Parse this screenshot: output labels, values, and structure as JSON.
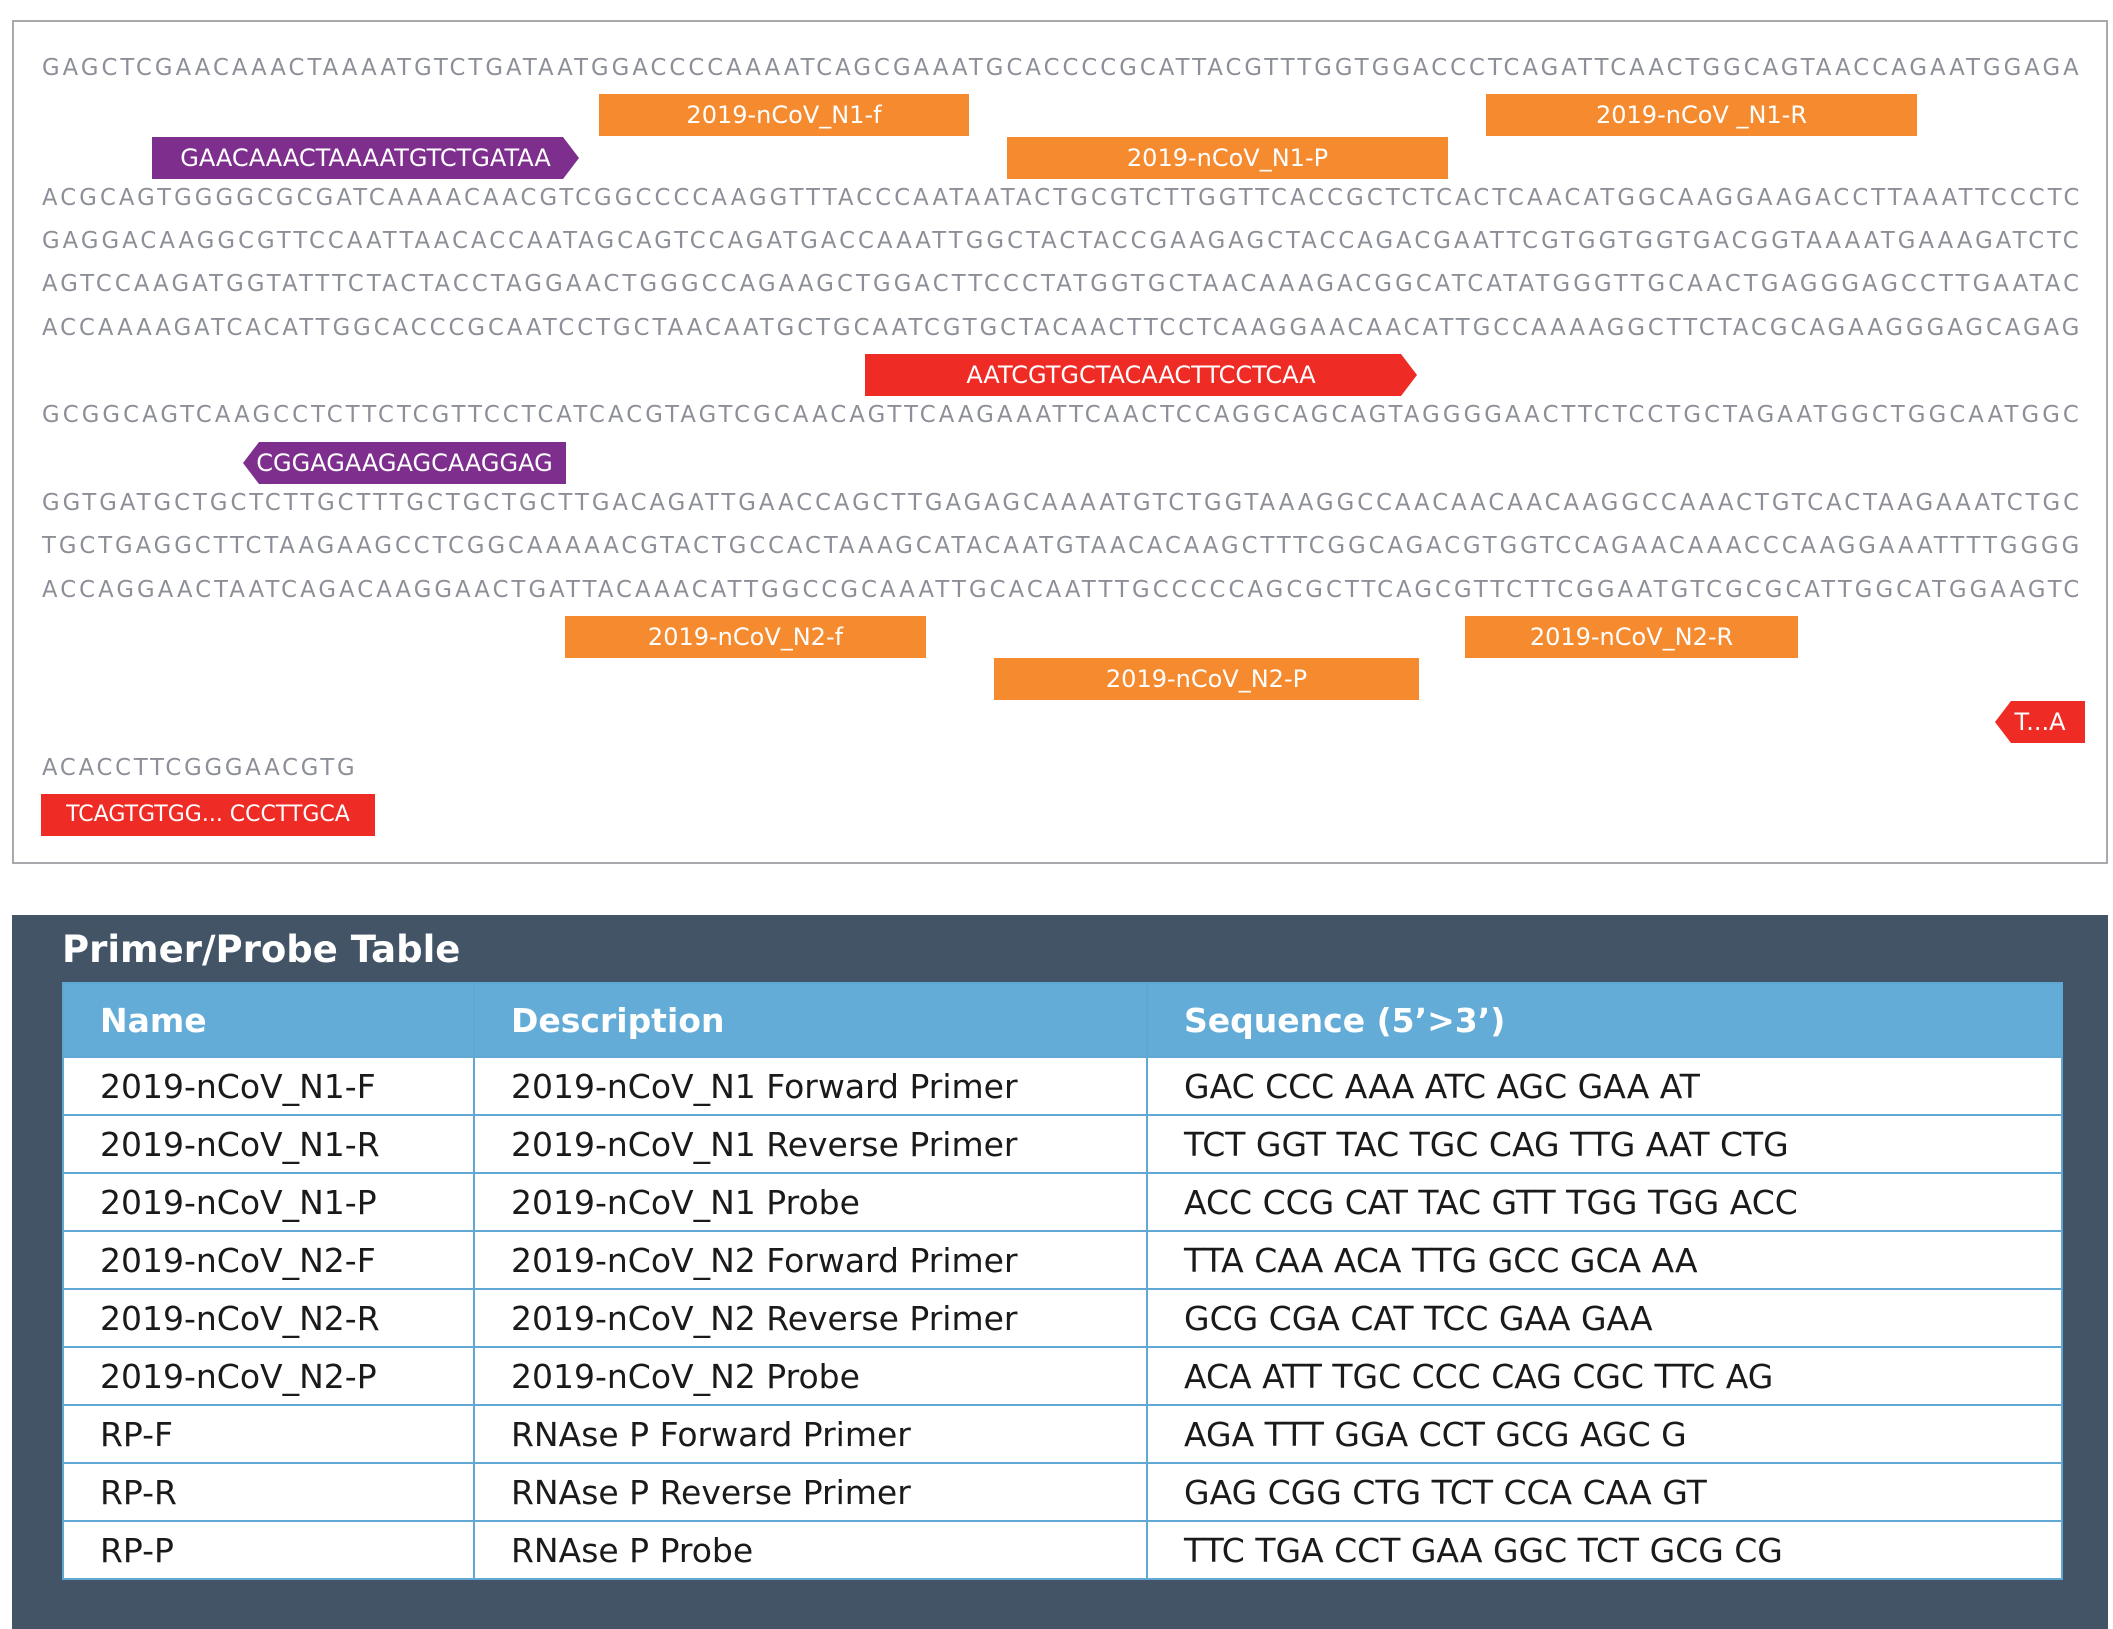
{
  "sequence_lines": [
    "GAGCTCGAACAAACTAAAATGTCTGATAATGGACCCCAAAATCAGCGAAATGCACCCCGCATTACGTTTGGTGGACCCTCAGATTCAACTGGCAGTAACCAGAATGGAGA",
    "ACGCAGTGGGGCGCGATCAAAACAACGTCGGCCCCAAGGTTTACCCAATAATACTGCGTCTTGGTTCACCGCTCTCACTCAACATGGCAAGGAAGACCTTAAATTCCCTC",
    "GAGGACAAGGCGTTCCAATTAACACCAATAGCAGTCCAGATGACCAAATTGGCTACTACCGAAGAGCTACCAGACGAATTCGTGGTGGTGACGGTAAAATGAAAGATCTC",
    "AGTCCAAGATGGTATTTCTACTACCTAGGAACTGGGCCAGAAGCTGGACTTCCCTATGGTGCTAACAAAGACGGCATCATATGGGTTGCAACTGAGGGAGCCTTGAATAC",
    "ACCAAAAGATCACATTGGCACCCGCAATCCTGCTAACAATGCTGCAATCGTGCTACAACTTCCTCAAGGAACAACATTGCCAAAAGGCTTCTACGCAGAAGGGAGCAGAG",
    "GCGGCAGTCAAGCCTCTTCTCGTTCCTCATCACGTAGTCGCAACAGTTCAAGAAATTCAACTCCAGGCAGCAGTAGGGGAACTTCTCCTGCTAGAATGGCTGGCAATGGC",
    "GGTGATGCTGCTCTTGCTTTGCTGCTGCTTGACAGATTGAACCAGCTTGAGAGCAAAATGTCTGGTAAAGGCCAACAACAACAAGGCCAAACTGTCACTAAGAAATCTGC",
    "TGCTGAGGCTTCTAAGAAGCCTCGGCAAAAACGTACTGCCACTAAAGCATACAATGTAACACAAGCTTTCGGCAGACGTGGTCCAGAACAAACCCAAGGAAATTTTGGGG",
    "ACCAGGAACTAATCAGACAAGGAACTGATTACAAACATTGGCCGCAAATTGCACAATTTGCCCCCAGCGCTTCAGCGTTCTTCGGAATGTCGCGCATTGGCATGGAAGTC",
    "ACACCTTCGGGAACGTG"
  ],
  "annotations": {
    "n1_f": "2019-nCoV_N1-f",
    "n1_r": "2019-nCoV _N1-R",
    "n1_p": "2019-nCoV_N1-P",
    "n2_f": "2019-nCoV_N2-f",
    "n2_r": "2019-nCoV_N2-R",
    "n2_p": "2019-nCoV_N2-P",
    "purple_forward": "GAACAAACTAAAATGTCTGATAA",
    "purple_reverse": "CGGAGAAGAGCAAGGAG",
    "red_forward": "AATCGTGCTACAACTTCCTCAA",
    "red_reverse_short": "T...A",
    "red_bottom": "TCAGTGTGG... CCCTTGCA"
  },
  "table": {
    "title": "Primer/Probe Table",
    "headers": [
      "Name",
      "Description",
      "Sequence (5’>3’)"
    ],
    "rows": [
      [
        "2019-nCoV_N1-F",
        "2019-nCoV_N1 Forward Primer",
        "GAC CCC AAA ATC AGC GAA AT"
      ],
      [
        "2019-nCoV_N1-R",
        "2019-nCoV_N1 Reverse Primer",
        "TCT GGT TAC TGC CAG TTG AAT CTG"
      ],
      [
        "2019-nCoV_N1-P",
        "2019-nCoV_N1 Probe",
        "ACC CCG CAT TAC GTT TGG TGG ACC"
      ],
      [
        "2019-nCoV_N2-F",
        "2019-nCoV_N2 Forward Primer",
        "TTA CAA ACA TTG GCC GCA AA"
      ],
      [
        "2019-nCoV_N2-R",
        "2019-nCoV_N2 Reverse Primer",
        "GCG CGA CAT TCC GAA GAA"
      ],
      [
        "2019-nCoV_N2-P",
        "2019-nCoV_N2 Probe",
        "ACA ATT TGC CCC CAG CGC TTC AG"
      ],
      [
        "RP-F",
        "RNAse P Forward Primer",
        "AGA TTT GGA CCT GCG AGC G"
      ],
      [
        "RP-R",
        "RNAse P Reverse Primer",
        "GAG CGG CTG TCT CCA CAA GT"
      ],
      [
        "RP-P",
        "RNAse P Probe",
        "TTC TGA CCT GAA GGC TCT GCG CG"
      ]
    ]
  },
  "colors": {
    "primer_orange": "#f58a2e",
    "purple": "#7e2e8d",
    "red": "#ee2b24",
    "sequence_gray": "#8c8f97",
    "panel_dark": "#425466",
    "table_header_blue": "#63acd7"
  }
}
